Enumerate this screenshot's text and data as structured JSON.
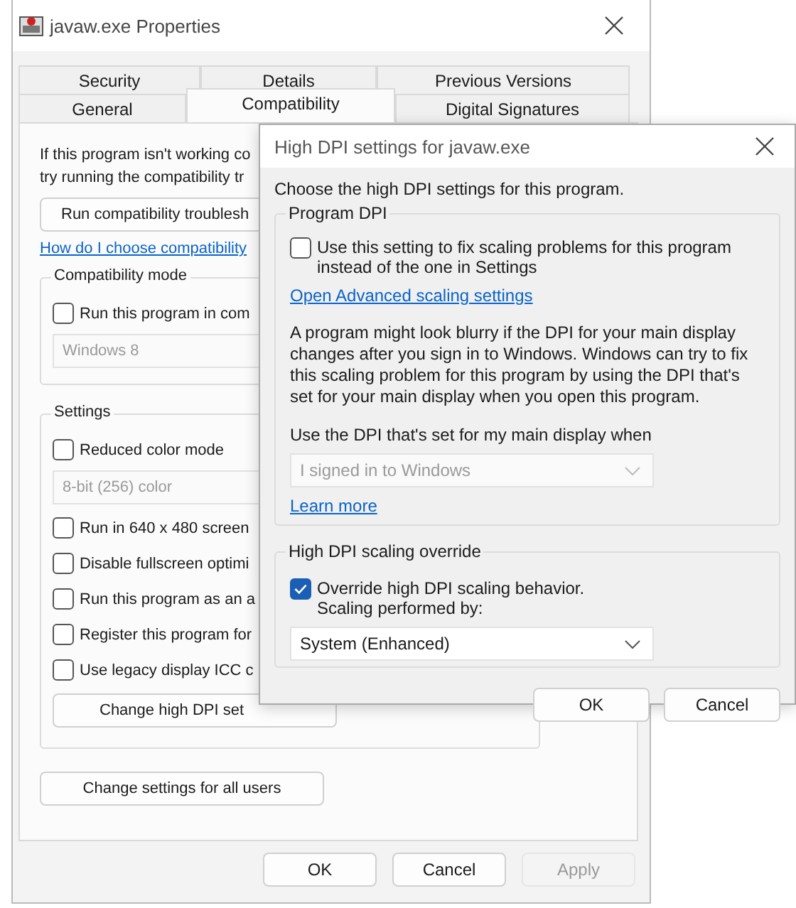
{
  "properties": {
    "title": "javaw.exe Properties",
    "tab_rows": [
      [
        {
          "label": "Security",
          "selected": false
        },
        {
          "label": "Details",
          "selected": false
        },
        {
          "label": "Previous Versions",
          "selected": false
        }
      ],
      [
        {
          "label": "General",
          "selected": false
        },
        {
          "label": "Compatibility",
          "selected": true
        },
        {
          "label": "Digital Signatures",
          "selected": false
        }
      ]
    ],
    "intro": "If this program isn't working co\ntry running the compatibility tr",
    "troubleshooter_button": "Run compatibility troublesh",
    "help_link": "How do I choose compatibility",
    "compatibility_mode": {
      "title": "Compatibility mode",
      "checkbox": {
        "label": "Run this program in com",
        "checked": false
      },
      "dropdown": {
        "value": "Windows 8",
        "disabled": true
      }
    },
    "settings": {
      "title": "Settings",
      "items": [
        {
          "kind": "checkbox",
          "label": "Reduced color mode",
          "checked": false
        },
        {
          "kind": "dropdown",
          "label": "8-bit (256) color",
          "disabled": true
        },
        {
          "kind": "checkbox",
          "label": "Run in 640 x 480 screen",
          "checked": false
        },
        {
          "kind": "checkbox",
          "label": "Disable fullscreen optimi",
          "checked": false
        },
        {
          "kind": "checkbox",
          "label": "Run this program as an a",
          "checked": false
        },
        {
          "kind": "checkbox",
          "label": "Register this program for",
          "checked": false
        },
        {
          "kind": "checkbox",
          "label": "Use legacy display ICC c",
          "checked": false
        },
        {
          "kind": "button",
          "label": "Change high DPI set"
        }
      ]
    },
    "all_users_button": "Change settings for all users",
    "buttons": [
      {
        "label": "OK",
        "disabled": false
      },
      {
        "label": "Cancel",
        "disabled": false
      },
      {
        "label": "Apply",
        "disabled": true
      }
    ]
  },
  "dialog": {
    "title": "High DPI settings for javaw.exe",
    "intro": "Choose the high DPI settings for this program.",
    "program_dpi": {
      "title": "Program DPI",
      "checkbox": {
        "label": "Use this setting to fix scaling problems for this program\ninstead of the one in Settings",
        "checked": false
      },
      "link": "Open Advanced scaling settings",
      "description": "A program might look blurry if the DPI for your main display\nchanges after you sign in to Windows. Windows can try to fix\nthis scaling problem for this program by using the DPI that's\nset for your main display when you open this program.",
      "dropdown_label": "Use the DPI that's set for my main display when",
      "dropdown": {
        "value": "I signed in to Windows",
        "disabled": true
      },
      "learn_more": "Learn more"
    },
    "override": {
      "title": "High DPI scaling override",
      "checkbox": {
        "label": "Override high DPI scaling behavior.\nScaling performed by:",
        "checked": true
      },
      "dropdown": {
        "value": "System (Enhanced)",
        "disabled": false
      }
    },
    "buttons": [
      {
        "label": "OK",
        "disabled": false
      },
      {
        "label": "Cancel",
        "disabled": false
      }
    ]
  }
}
